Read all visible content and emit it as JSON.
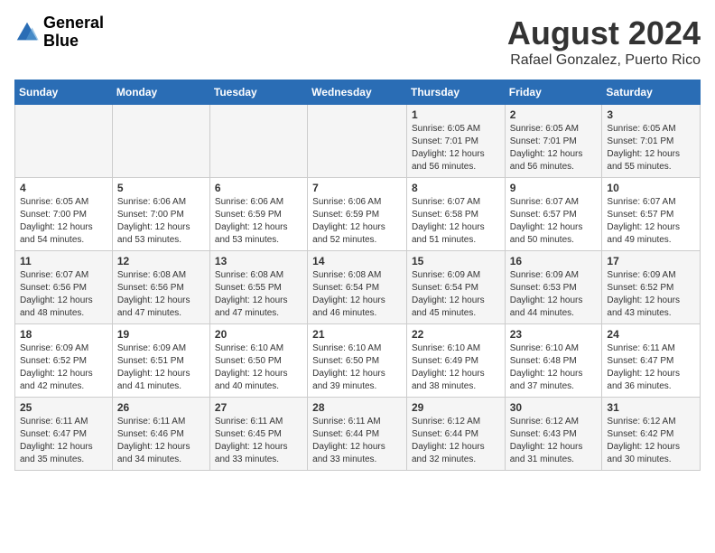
{
  "header": {
    "logo_line1": "General",
    "logo_line2": "Blue",
    "month_year": "August 2024",
    "location": "Rafael Gonzalez, Puerto Rico"
  },
  "weekdays": [
    "Sunday",
    "Monday",
    "Tuesday",
    "Wednesday",
    "Thursday",
    "Friday",
    "Saturday"
  ],
  "weeks": [
    [
      {
        "day": "",
        "info": ""
      },
      {
        "day": "",
        "info": ""
      },
      {
        "day": "",
        "info": ""
      },
      {
        "day": "",
        "info": ""
      },
      {
        "day": "1",
        "info": "Sunrise: 6:05 AM\nSunset: 7:01 PM\nDaylight: 12 hours\nand 56 minutes."
      },
      {
        "day": "2",
        "info": "Sunrise: 6:05 AM\nSunset: 7:01 PM\nDaylight: 12 hours\nand 56 minutes."
      },
      {
        "day": "3",
        "info": "Sunrise: 6:05 AM\nSunset: 7:01 PM\nDaylight: 12 hours\nand 55 minutes."
      }
    ],
    [
      {
        "day": "4",
        "info": "Sunrise: 6:05 AM\nSunset: 7:00 PM\nDaylight: 12 hours\nand 54 minutes."
      },
      {
        "day": "5",
        "info": "Sunrise: 6:06 AM\nSunset: 7:00 PM\nDaylight: 12 hours\nand 53 minutes."
      },
      {
        "day": "6",
        "info": "Sunrise: 6:06 AM\nSunset: 6:59 PM\nDaylight: 12 hours\nand 53 minutes."
      },
      {
        "day": "7",
        "info": "Sunrise: 6:06 AM\nSunset: 6:59 PM\nDaylight: 12 hours\nand 52 minutes."
      },
      {
        "day": "8",
        "info": "Sunrise: 6:07 AM\nSunset: 6:58 PM\nDaylight: 12 hours\nand 51 minutes."
      },
      {
        "day": "9",
        "info": "Sunrise: 6:07 AM\nSunset: 6:57 PM\nDaylight: 12 hours\nand 50 minutes."
      },
      {
        "day": "10",
        "info": "Sunrise: 6:07 AM\nSunset: 6:57 PM\nDaylight: 12 hours\nand 49 minutes."
      }
    ],
    [
      {
        "day": "11",
        "info": "Sunrise: 6:07 AM\nSunset: 6:56 PM\nDaylight: 12 hours\nand 48 minutes."
      },
      {
        "day": "12",
        "info": "Sunrise: 6:08 AM\nSunset: 6:56 PM\nDaylight: 12 hours\nand 47 minutes."
      },
      {
        "day": "13",
        "info": "Sunrise: 6:08 AM\nSunset: 6:55 PM\nDaylight: 12 hours\nand 47 minutes."
      },
      {
        "day": "14",
        "info": "Sunrise: 6:08 AM\nSunset: 6:54 PM\nDaylight: 12 hours\nand 46 minutes."
      },
      {
        "day": "15",
        "info": "Sunrise: 6:09 AM\nSunset: 6:54 PM\nDaylight: 12 hours\nand 45 minutes."
      },
      {
        "day": "16",
        "info": "Sunrise: 6:09 AM\nSunset: 6:53 PM\nDaylight: 12 hours\nand 44 minutes."
      },
      {
        "day": "17",
        "info": "Sunrise: 6:09 AM\nSunset: 6:52 PM\nDaylight: 12 hours\nand 43 minutes."
      }
    ],
    [
      {
        "day": "18",
        "info": "Sunrise: 6:09 AM\nSunset: 6:52 PM\nDaylight: 12 hours\nand 42 minutes."
      },
      {
        "day": "19",
        "info": "Sunrise: 6:09 AM\nSunset: 6:51 PM\nDaylight: 12 hours\nand 41 minutes."
      },
      {
        "day": "20",
        "info": "Sunrise: 6:10 AM\nSunset: 6:50 PM\nDaylight: 12 hours\nand 40 minutes."
      },
      {
        "day": "21",
        "info": "Sunrise: 6:10 AM\nSunset: 6:50 PM\nDaylight: 12 hours\nand 39 minutes."
      },
      {
        "day": "22",
        "info": "Sunrise: 6:10 AM\nSunset: 6:49 PM\nDaylight: 12 hours\nand 38 minutes."
      },
      {
        "day": "23",
        "info": "Sunrise: 6:10 AM\nSunset: 6:48 PM\nDaylight: 12 hours\nand 37 minutes."
      },
      {
        "day": "24",
        "info": "Sunrise: 6:11 AM\nSunset: 6:47 PM\nDaylight: 12 hours\nand 36 minutes."
      }
    ],
    [
      {
        "day": "25",
        "info": "Sunrise: 6:11 AM\nSunset: 6:47 PM\nDaylight: 12 hours\nand 35 minutes."
      },
      {
        "day": "26",
        "info": "Sunrise: 6:11 AM\nSunset: 6:46 PM\nDaylight: 12 hours\nand 34 minutes."
      },
      {
        "day": "27",
        "info": "Sunrise: 6:11 AM\nSunset: 6:45 PM\nDaylight: 12 hours\nand 33 minutes."
      },
      {
        "day": "28",
        "info": "Sunrise: 6:11 AM\nSunset: 6:44 PM\nDaylight: 12 hours\nand 33 minutes."
      },
      {
        "day": "29",
        "info": "Sunrise: 6:12 AM\nSunset: 6:44 PM\nDaylight: 12 hours\nand 32 minutes."
      },
      {
        "day": "30",
        "info": "Sunrise: 6:12 AM\nSunset: 6:43 PM\nDaylight: 12 hours\nand 31 minutes."
      },
      {
        "day": "31",
        "info": "Sunrise: 6:12 AM\nSunset: 6:42 PM\nDaylight: 12 hours\nand 30 minutes."
      }
    ]
  ]
}
